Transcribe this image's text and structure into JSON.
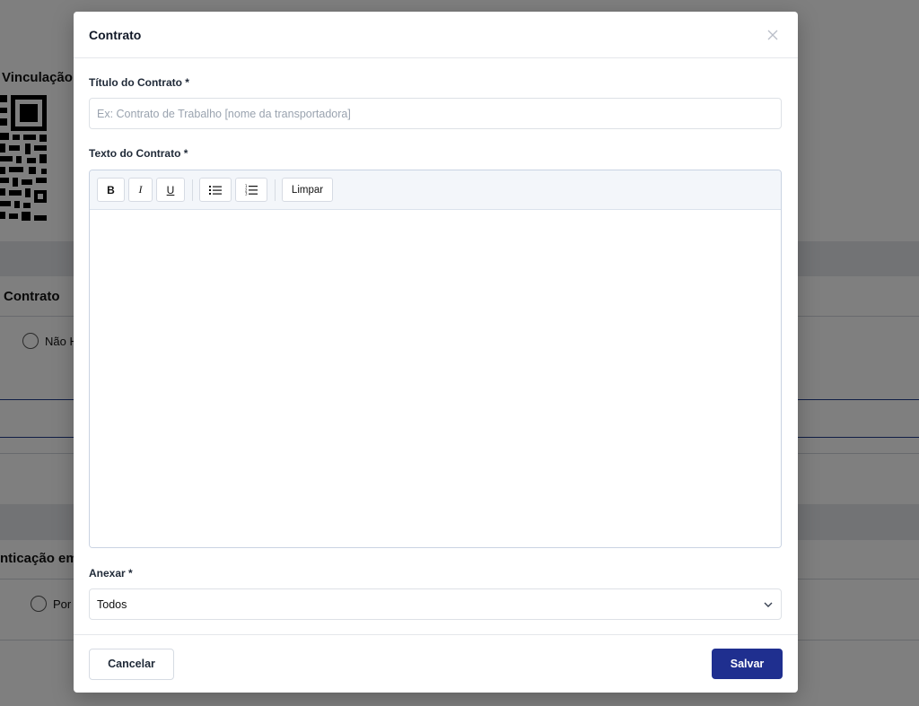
{
  "background": {
    "heading_vinculacao": "Vinculação",
    "heading_contrato": "Contrato",
    "radio_nao": "Não H",
    "heading_autenticacao": "nticação em I",
    "radio_por": "Por"
  },
  "modal": {
    "title": "Contrato",
    "close_label": "×",
    "title_field": {
      "label": "Título do Contrato *",
      "value": "",
      "placeholder": "Ex: Contrato de Trabalho [nome da transportadora]"
    },
    "text_field": {
      "label": "Texto do Contrato *",
      "value": ""
    },
    "toolbar": {
      "bold": "B",
      "italic": "I",
      "underline": "U",
      "clear": "Limpar"
    },
    "attach_field": {
      "label": "Anexar *",
      "selected": "Todos"
    },
    "footer": {
      "cancel": "Cancelar",
      "save": "Salvar"
    }
  },
  "colors": {
    "primary": "#1f2f8f",
    "overlay": "rgba(0,0,0,0.5)"
  }
}
